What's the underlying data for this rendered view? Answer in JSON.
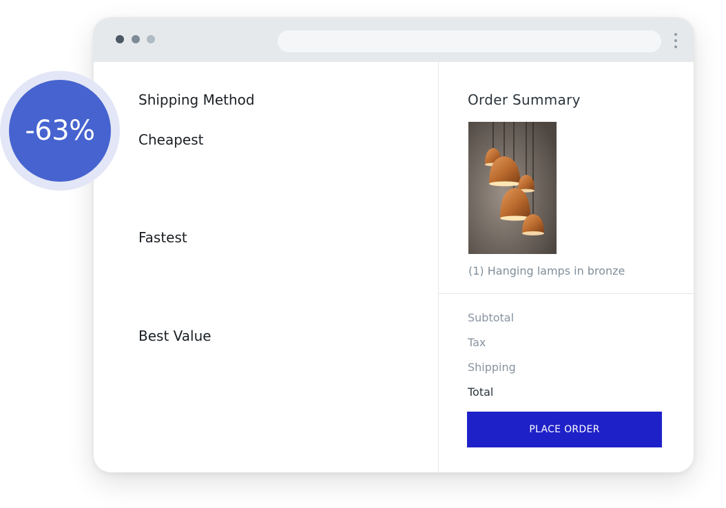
{
  "browser": {
    "url": ""
  },
  "shipping": {
    "title": "Shipping Method",
    "options": [
      {
        "label": "Cheapest"
      },
      {
        "label": "Fastest"
      },
      {
        "label": "Best Value"
      }
    ]
  },
  "order_summary": {
    "title": "Order Summary",
    "product_caption": "(1) Hanging lamps in bronze",
    "rows": [
      {
        "label": "Subtotal"
      },
      {
        "label": "Tax"
      },
      {
        "label": "Shipping"
      },
      {
        "label": "Total"
      }
    ],
    "place_order_label": "PLACE ORDER"
  },
  "discount_badge": {
    "text": "-63%"
  },
  "colors": {
    "accent_button": "#1f21c8",
    "badge": "#4663cf",
    "chrome": "#e6e9eb"
  },
  "icons": {
    "window_controls": [
      "dot-dark",
      "dot-mid",
      "dot-light"
    ],
    "menu": "kebab-menu-icon",
    "product_image": "hanging-bronze-lamps-photo"
  }
}
